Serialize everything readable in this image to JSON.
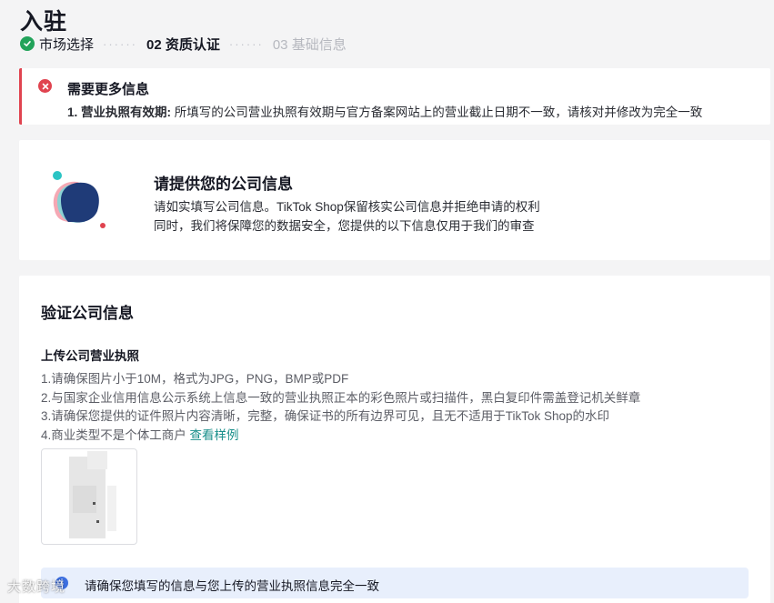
{
  "page": {
    "title": "入驻"
  },
  "steps": [
    {
      "label": "市场选择",
      "state": "done"
    },
    {
      "label": "02 资质认证",
      "state": "current"
    },
    {
      "label": "03 基础信息",
      "state": "pending"
    }
  ],
  "step_separator": "······",
  "alert": {
    "title": "需要更多信息",
    "item_label": "1. 营业执照有效期:",
    "item_text": " 所填写的公司营业执照有效期与官方备案网站上的营业截止日期不一致，请核对并修改为完全一致"
  },
  "info_card": {
    "title": "请提供您的公司信息",
    "line1": "请如实填写公司信息。TikTok Shop保留核实公司信息并拒绝申请的权利",
    "line2": "同时，我们将保障您的数据安全，您提供的以下信息仅用于我们的审查"
  },
  "verify": {
    "title": "验证公司信息",
    "upload_title": "上传公司营业执照",
    "rules": [
      "1.请确保图片小于10M，格式为JPG，PNG，BMP或PDF",
      "2.与国家企业信用信息公示系统上信息一致的营业执照正本的彩色照片或扫描件，黑白复印件需盖登记机关鲜章",
      "3.请确保您提供的证件照片内容清晰，完整，确保证书的所有边界可见，且无不适用于TikTok Shop的水印"
    ],
    "rule4_text": "4.商业类型不是个体工商户 ",
    "rule4_link": "查看样例",
    "notice": "请确保您填写的信息与您上传的营业执照信息完全一致"
  },
  "watermark": "大数跨境",
  "colors": {
    "success": "#22a35a",
    "error": "#e0434f",
    "link": "#1a8f8b",
    "info": "#3d6fe0"
  }
}
